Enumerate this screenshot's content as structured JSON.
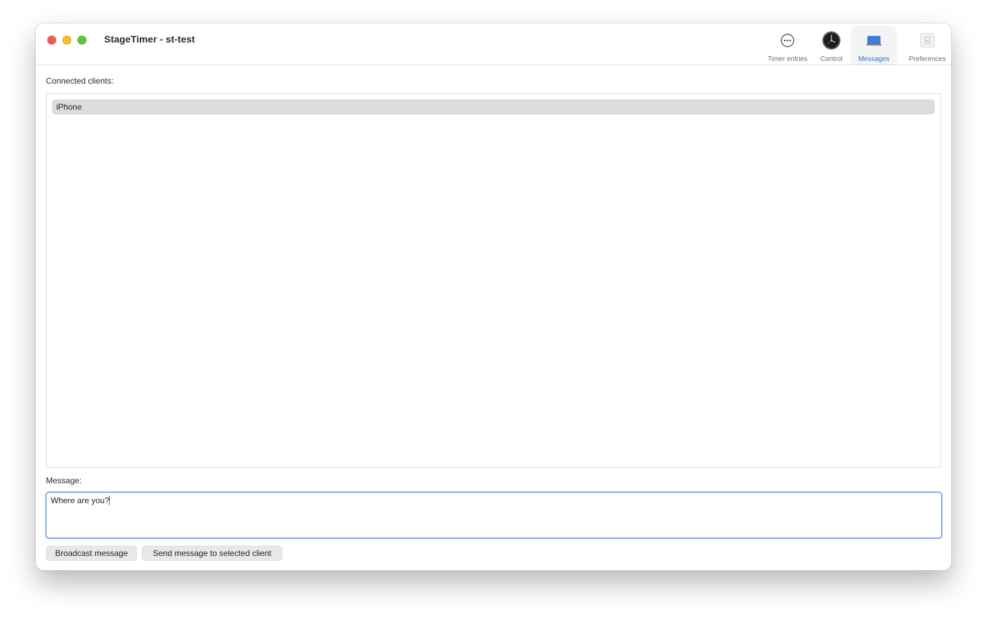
{
  "window": {
    "title": "StageTimer - st-test"
  },
  "toolbar": {
    "items": [
      {
        "label": "Timer entries",
        "icon": "ellipsis-circle-icon"
      },
      {
        "label": "Control",
        "icon": "clock-icon"
      },
      {
        "label": "Messages",
        "icon": "laptop-icon",
        "active": true
      },
      {
        "label": "Preferences",
        "icon": "switch-icon"
      }
    ],
    "accent": "#2f6fd6"
  },
  "clients": {
    "label": "Connected clients:",
    "items": [
      "iPhone"
    ],
    "selected_index": 0
  },
  "message": {
    "label": "Message:",
    "value": "Where are you?"
  },
  "buttons": {
    "broadcast": "Broadcast message",
    "send_selected": "Send message to selected client"
  }
}
